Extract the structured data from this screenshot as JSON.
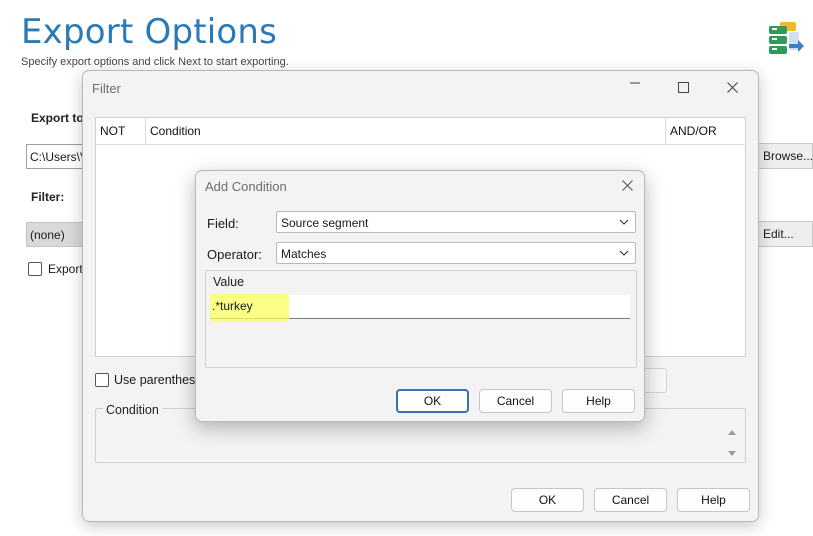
{
  "background": {
    "title": "Export Options",
    "subtitle": "Specify export options and click Next to start exporting.",
    "export_to_label": "Export to",
    "path_value": "C:\\Users\\V",
    "browse_label": "Browse...",
    "filter_label": "Filter:",
    "filter_value": "(none)",
    "edit_label": "Edit...",
    "export_checkbox_label": "Export",
    "export_checkbox_checked": false
  },
  "filter_dialog": {
    "title": "Filter",
    "columns": [
      "NOT",
      "Condition",
      "AND/OR"
    ],
    "use_parentheses_label": "Use parenthes",
    "use_parentheses_checked": false,
    "condition_legend": "Condition",
    "buttons": {
      "ok": "OK",
      "cancel": "Cancel",
      "help": "Help"
    }
  },
  "add_condition_dialog": {
    "title": "Add Condition",
    "field_label": "Field:",
    "field_value": "Source segment",
    "operator_label": "Operator:",
    "operator_value": "Matches",
    "value_legend": "Value",
    "value_text": ".*turkey",
    "highlight_color": "#fbff5e",
    "buttons": {
      "ok": "OK",
      "cancel": "Cancel",
      "help": "Help"
    }
  },
  "colors": {
    "title_blue": "#2a7ab8",
    "accent_border": "#3a6fb0"
  }
}
